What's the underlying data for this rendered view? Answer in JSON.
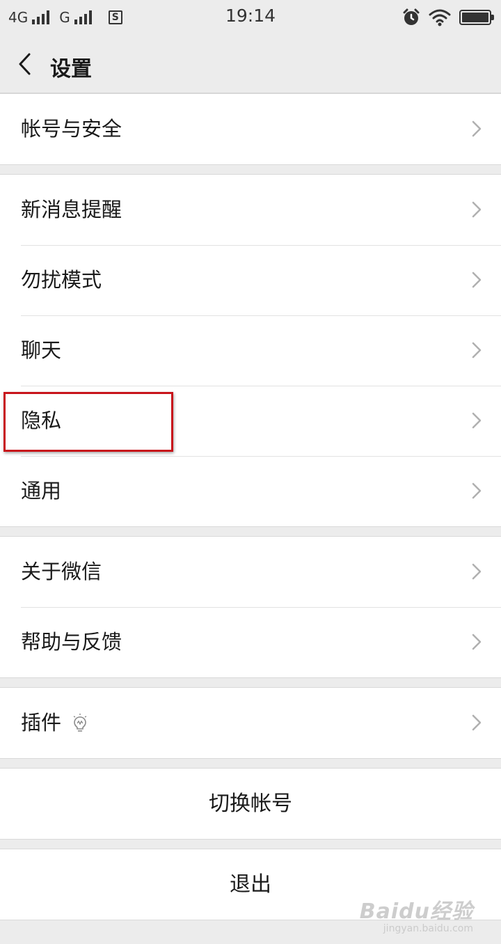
{
  "status_bar": {
    "network_1": "4G",
    "network_2": "G",
    "sim_icon": "S",
    "time": "19:14",
    "icons": [
      "alarm-icon",
      "wifi-icon",
      "battery-icon"
    ],
    "battery_level": 1.0
  },
  "header": {
    "back_icon": "chevron-left-icon",
    "title": "设置"
  },
  "groups": [
    {
      "items": [
        {
          "label": "帐号与安全"
        }
      ]
    },
    {
      "items": [
        {
          "label": "新消息提醒"
        },
        {
          "label": "勿扰模式"
        },
        {
          "label": "聊天"
        },
        {
          "label": "隐私",
          "highlighted": true
        },
        {
          "label": "通用"
        }
      ]
    },
    {
      "items": [
        {
          "label": "关于微信"
        },
        {
          "label": "帮助与反馈"
        }
      ]
    },
    {
      "items": [
        {
          "label": "插件",
          "icon": "lightbulb-icon"
        }
      ]
    }
  ],
  "actions": {
    "switch_account": "切换帐号",
    "logout": "退出"
  },
  "colors": {
    "background": "#ececec",
    "highlight_border": "#c8141b"
  },
  "watermark": {
    "main": "Baidu经验",
    "sub": "jingyan.baidu.com"
  }
}
